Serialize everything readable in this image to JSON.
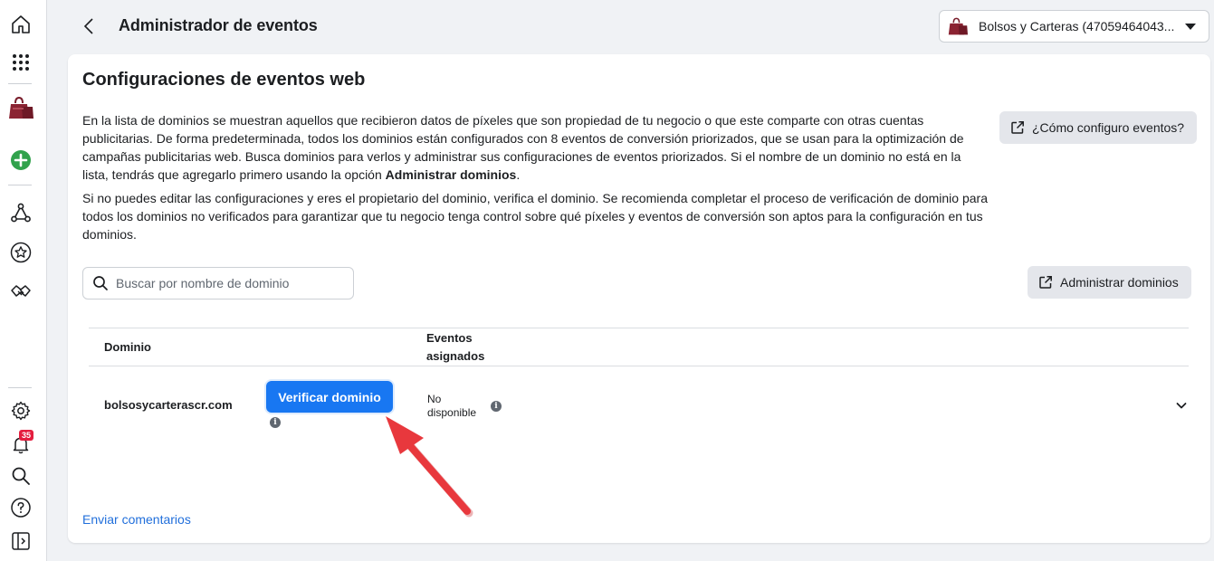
{
  "header": {
    "title": "Administrador de eventos",
    "account_name": "Bolsos y Carteras (47059464043..."
  },
  "rail": {
    "notification_count": "35"
  },
  "card": {
    "title": "Configuraciones de eventos web",
    "paragraph1_before_bold": "En la lista de dominios se muestran aquellos que recibieron datos de píxeles que son propiedad de tu negocio o que este comparte con otras cuentas publicitarias. De forma predeterminada, todos los dominios están configurados con 8 eventos de conversión priorizados, que se usan para la optimización de campañas publicitarias web. Busca dominios para verlos y administrar sus configuraciones de eventos priorizados. Si el nombre de un dominio no está en la lista, tendrás que agregarlo primero usando la opción ",
    "paragraph1_bold": "Administrar dominios",
    "paragraph1_after_bold": ".",
    "paragraph2": "Si no puedes editar las configuraciones y eres el propietario del dominio, verifica el dominio. Se recomienda completar el proceso de verificación de dominio para todos los dominios no verificados para garantizar que tu negocio tenga control sobre qué píxeles y eventos de conversión son aptos para la configuración en tus dominios.",
    "help_button": "¿Cómo configuro eventos?",
    "search_placeholder": "Buscar por nombre de dominio",
    "manage_button": "Administrar dominios",
    "feedback_link": "Enviar comentarios"
  },
  "table": {
    "columns": [
      "Dominio",
      "Eventos asignados"
    ],
    "rows": [
      {
        "domain": "bolsosycarterascr.com",
        "verify_button": "Verificar dominio",
        "events": "No disponible"
      }
    ]
  },
  "colors": {
    "primary": "#1877f2",
    "link": "#216fdb",
    "badge": "#e41e3f",
    "arrow": "#e8383d",
    "add_button": "#31a24c"
  }
}
